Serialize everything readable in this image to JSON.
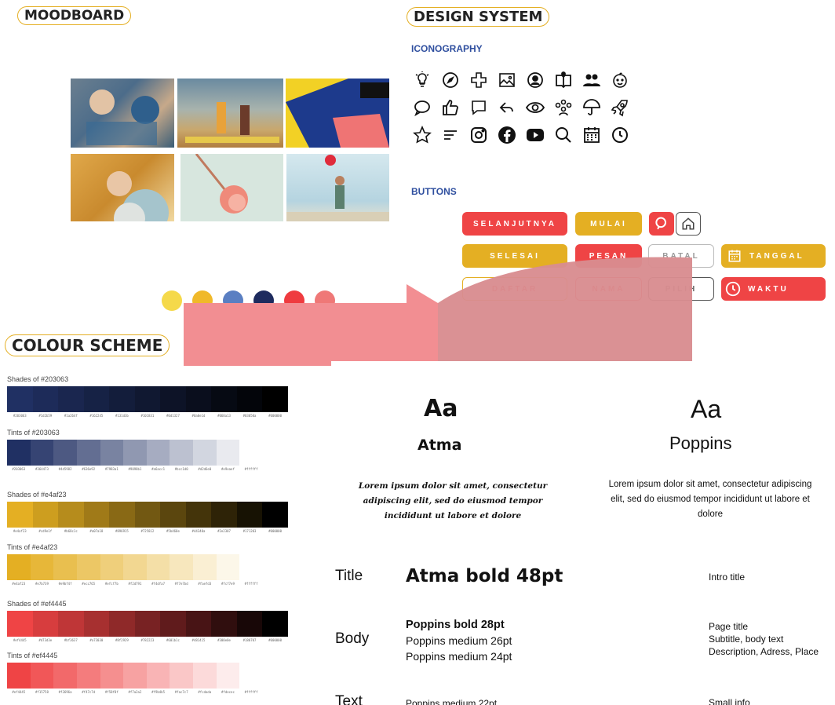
{
  "sections": {
    "moodboard": "MOODBOARD",
    "design_system": "DESIGN SYSTEM",
    "iconography": "ICONOGRAPHY",
    "buttons": "BUTTONS",
    "colour_scheme": "COLOUR SCHEME"
  },
  "moodboard": {
    "dot_colors": [
      "#f5d94a",
      "#f0b92a",
      "#5a7fc2",
      "#1e2b5e",
      "#ef3b3f",
      "#ef7877"
    ]
  },
  "icons": [
    [
      "lightbulb-icon",
      "compass-icon",
      "first-aid-cross-icon",
      "image-icon",
      "user-circle-icon",
      "open-book-icon",
      "users-icon",
      "baby-face-icon"
    ],
    [
      "speech-bubble-icon",
      "thumbs-up-icon",
      "chat-icon",
      "reply-icon",
      "eye-icon",
      "group-icon",
      "umbrella-icon",
      "rocket-icon"
    ],
    [
      "star-icon",
      "menu-lines-icon",
      "instagram-icon",
      "facebook-icon",
      "youtube-icon",
      "search-icon",
      "calendar-icon",
      "clock-icon"
    ]
  ],
  "buttons": {
    "selanjutnya": "SELANJUTNYA",
    "mulai": "MULAI",
    "selesai": "SELESAI",
    "pesan": "PESAN",
    "batal": "BATAL",
    "tanggal": "TANGGAL",
    "daftar": "DAFTAR",
    "nama": "NAMA",
    "pilih": "PILIH",
    "waktu": "WAKTU",
    "colors": {
      "red": "#ef4445",
      "yellow": "#e4af23"
    }
  },
  "palettes": [
    {
      "label": "Shades of #203063",
      "colors": [
        "#203063",
        "#1d2b59",
        "#1a264f",
        "#162245",
        "#131d3b",
        "#101831",
        "#0d1327",
        "#0a0e1d",
        "#060a13",
        "#03050a",
        "#000000"
      ],
      "hex": [
        "#203063",
        "#1d2b59",
        "#1a264f",
        "#162245",
        "#131d3b",
        "#101831",
        "#0d1327",
        "#0a0e1d",
        "#060a13",
        "#03050a",
        "#000000"
      ]
    },
    {
      "label": "Tints of #203063",
      "colors": [
        "#203063",
        "#364473",
        "#4d5982",
        "#636e92",
        "#7983a1",
        "#9098b1",
        "#a6acc1",
        "#bcc1d0",
        "#d2d6e0",
        "#e9eaef",
        "#ffffff"
      ],
      "hex": [
        "#203063",
        "#364473",
        "#4d5982",
        "#636e92",
        "#7983a1",
        "#9098b1",
        "#a6acc1",
        "#bcc1d0",
        "#d2d6e0",
        "#e9eaef",
        "#ffffff"
      ]
    },
    {
      "label": "Shades of #e4af23",
      "colors": [
        "#e4af23",
        "#cd9e1f",
        "#b68c1c",
        "#a07a18",
        "#896915",
        "#725812",
        "#5b460e",
        "#44340a",
        "#2e2307",
        "#171203",
        "#000000"
      ],
      "hex": [
        "#e4af23",
        "#cd9e1f",
        "#b68c1c",
        "#a07a18",
        "#896915",
        "#725812",
        "#5b460e",
        "#44340a",
        "#2e2307",
        "#171203",
        "#000000"
      ]
    },
    {
      "label": "Tints of #e4af23",
      "colors": [
        "#e4af23",
        "#e7b739",
        "#e9bf4f",
        "#ecc765",
        "#efcf7b",
        "#f2d791",
        "#f4dfa7",
        "#f7e7bd",
        "#faefd3",
        "#fcf7e9",
        "#ffffff"
      ],
      "hex": [
        "#e4af23",
        "#e7b739",
        "#e9bf4f",
        "#ecc765",
        "#efcf7b",
        "#f2d791",
        "#f4dfa7",
        "#f7e7bd",
        "#faefd3",
        "#fcf7e9",
        "#ffffff"
      ]
    },
    {
      "label": "Shades of #ef4445",
      "colors": [
        "#ef4445",
        "#d73d3e",
        "#bf3637",
        "#a73030",
        "#8f2929",
        "#782223",
        "#601b1c",
        "#481415",
        "#300e0e",
        "#180707",
        "#000000"
      ],
      "hex": [
        "#ef4445",
        "#d73d3e",
        "#bf3637",
        "#a73030",
        "#8f2929",
        "#782223",
        "#601b1c",
        "#481415",
        "#300e0e",
        "#180707",
        "#000000"
      ]
    },
    {
      "label": "Tints of #ef4445",
      "colors": [
        "#ef4445",
        "#f15758",
        "#f2696a",
        "#f47c7d",
        "#f58f8f",
        "#f7a2a2",
        "#f9b4b5",
        "#fac7c7",
        "#fcdada",
        "#fdecec",
        "#ffffff"
      ],
      "hex": [
        "#ef4445",
        "#f15758",
        "#f2696a",
        "#f47c7d",
        "#f58f8f",
        "#f7a2a2",
        "#f9b4b5",
        "#fac7c7",
        "#fcdada",
        "#fdecec",
        "#ffffff"
      ]
    }
  ],
  "typography": {
    "aa": "Aa",
    "font_atma": "Atma",
    "font_poppins": "Poppins",
    "lorem": "Lorem ipsum dolor sit amet, consectetur adipiscing elit, sed do eiusmod tempor incididunt ut labore et dolore",
    "rows": {
      "title": {
        "label": "Title",
        "spec": "Atma bold 48pt",
        "use": "Intro title"
      },
      "body": {
        "label": "Body",
        "spec": [
          "Poppins bold 28pt",
          "Poppins medium 26pt",
          "Poppins medium 24pt"
        ],
        "use": [
          "Page title",
          "Subtitle, body text",
          "Description, Adress, Place"
        ]
      },
      "text": {
        "label": "Text",
        "spec": "Poppins medium 22pt",
        "use": "Small info"
      }
    }
  }
}
